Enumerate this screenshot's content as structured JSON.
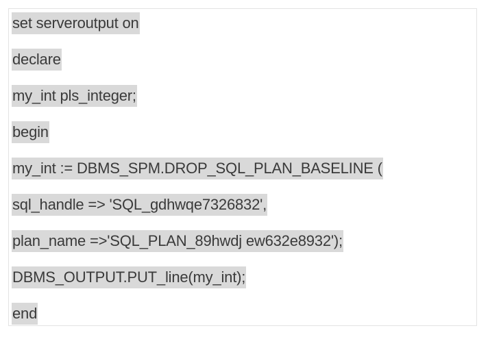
{
  "code": {
    "lines": [
      "set serveroutput on",
      "declare",
      "my_int pls_integer;",
      "begin",
      "my_int := DBMS_SPM.DROP_SQL_PLAN_BASELINE (",
      "sql_handle => 'SQL_gdhwqe7326832',",
      "plan_name =>'SQL_PLAN_89hwdj ew632e8932');",
      "DBMS_OUTPUT.PUT_line(my_int);",
      "end"
    ],
    "highlight_color": "#d9d9d9",
    "text_color": "#3a3a3a"
  }
}
